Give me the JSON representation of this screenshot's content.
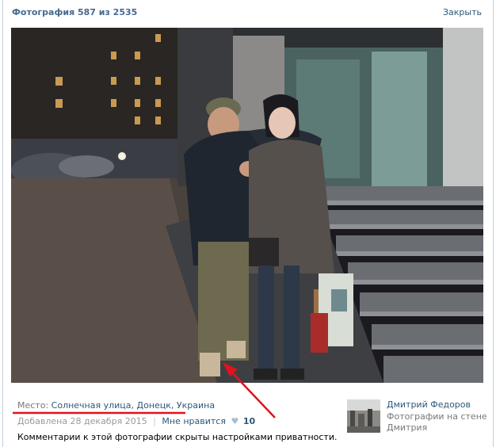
{
  "header": {
    "title": "Фотография 587 из 2535",
    "close_label": "Закрыть"
  },
  "details": {
    "place_label": "Место:",
    "place_value": "Солнечная улица, Донецк, Украина",
    "added_label": "Добавлена 28 декабря 2015",
    "separator": "|",
    "like_label": "Мне нравится",
    "heart_glyph": "♥",
    "like_count": "10",
    "privacy_note": "Комментарии к этой фотографии скрыты настройками приватности."
  },
  "author": {
    "name": "Дмитрий Федоров",
    "album_line1": "Фотографии на стене",
    "album_line2": "Дмитрия"
  },
  "colors": {
    "link": "#2b587a",
    "header_title": "#45688e",
    "annotation": "#e0121f"
  }
}
